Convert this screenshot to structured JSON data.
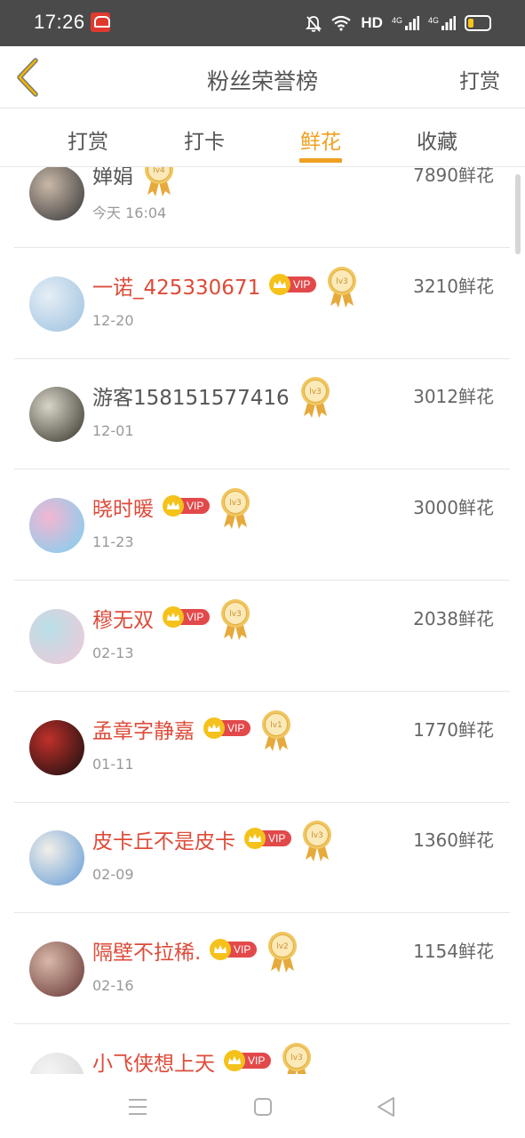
{
  "status_bar": {
    "time": "17:26",
    "network": "HD",
    "signal_1": "4G",
    "signal_2": "4G",
    "battery_level": 0.25,
    "icons": [
      "app-notification-icon",
      "mute-bell-icon",
      "wifi-icon",
      "signal-icon",
      "battery-icon"
    ]
  },
  "header": {
    "back_icon": "chevron-left-icon",
    "title": "粉丝荣誉榜",
    "action_label": "打赏"
  },
  "tabs": [
    {
      "label": "打赏",
      "active": false
    },
    {
      "label": "打卡",
      "active": false
    },
    {
      "label": "鲜花",
      "active": true
    },
    {
      "label": "收藏",
      "active": false
    }
  ],
  "colors": {
    "accent": "#f0a020",
    "vip_name": "#dd4b39",
    "normal_name": "#555555",
    "vip_badge": "#e2494b",
    "crown": "#f4c21b",
    "medal": "#e6a93c"
  },
  "vip_label": "VIP",
  "fans": [
    {
      "name": "婵娟",
      "vip": false,
      "level": "lv4",
      "date": "今天 16:04",
      "flowers": "7890鲜花"
    },
    {
      "name": "一诺_425330671",
      "vip": true,
      "level": "lv3",
      "date": "12-20",
      "flowers": "3210鲜花"
    },
    {
      "name": "游客158151577416",
      "vip": false,
      "level": "lv3",
      "date": "12-01",
      "flowers": "3012鲜花"
    },
    {
      "name": "晓时暖",
      "vip": true,
      "level": "lv3",
      "date": "11-23",
      "flowers": "3000鲜花"
    },
    {
      "name": "穆无双",
      "vip": true,
      "level": "lv3",
      "date": "02-13",
      "flowers": "2038鲜花"
    },
    {
      "name": "孟章字静嘉",
      "vip": true,
      "level": "lv1",
      "date": "01-11",
      "flowers": "1770鲜花"
    },
    {
      "name": "皮卡丘不是皮卡",
      "vip": true,
      "level": "lv3",
      "date": "02-09",
      "flowers": "1360鲜花"
    },
    {
      "name": "隔壁不拉稀.",
      "vip": true,
      "level": "lv2",
      "date": "02-16",
      "flowers": "1154鲜花"
    },
    {
      "name": "小飞侠想上天",
      "vip": true,
      "level": "lv3",
      "date": "",
      "flowers": ""
    }
  ],
  "nav": {
    "menu_icon": "menu-icon",
    "home_icon": "home-square-icon",
    "back_icon": "back-triangle-icon"
  }
}
